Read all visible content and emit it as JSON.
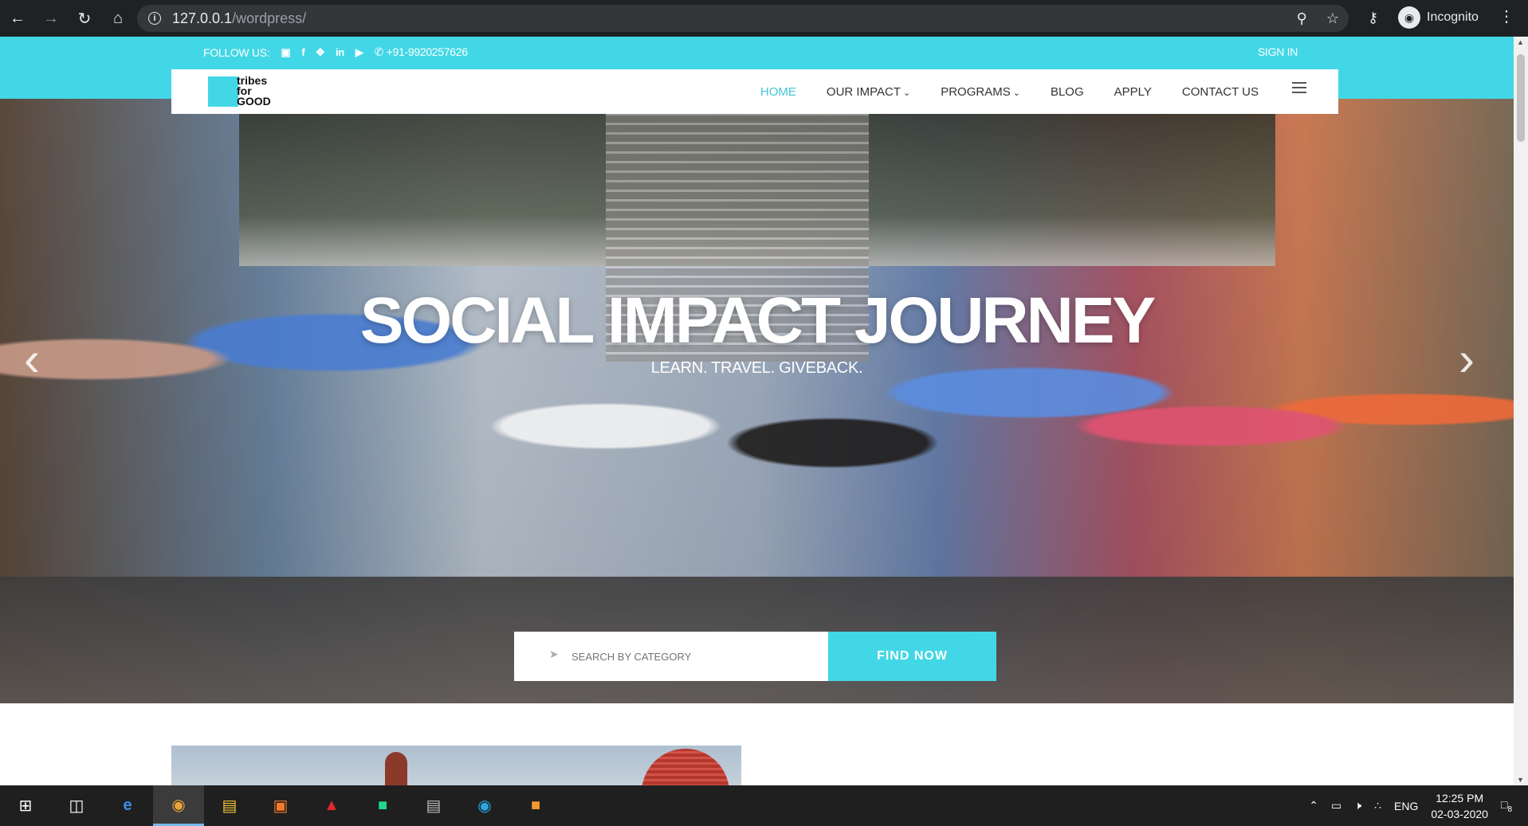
{
  "browser": {
    "url_host": "127.0.0.1",
    "url_path": "/wordpress/",
    "profile_label": "Incognito"
  },
  "topbar": {
    "follow_label": "FOLLOW US:",
    "phone": "+91-9920257626",
    "signin": "SIGN IN",
    "social": [
      "instagram-icon",
      "facebook-icon",
      "twitter-icon",
      "linkedin-icon",
      "youtube-icon"
    ]
  },
  "logo": {
    "line1": "tribes",
    "line2": "for",
    "line3": "GOOD"
  },
  "nav": {
    "home": "HOME",
    "our_impact": "OUR IMPACT",
    "programs": "PROGRAMS",
    "blog": "BLOG",
    "apply": "APPLY",
    "contact": "CONTACT US"
  },
  "hero": {
    "title": "SOCIAL IMPACT JOURNEY",
    "subtitle": "LEARN. TRAVEL. GIVEBACK."
  },
  "search": {
    "placeholder": "SEARCH BY CATEGORY",
    "button": "FIND NOW"
  },
  "taskbar": {
    "tray_lang": "ENG",
    "time": "12:25 PM",
    "date": "02-03-2020",
    "notifications": "8"
  },
  "colors": {
    "accent": "#42d7e6",
    "chrome": "#202124",
    "taskbar": "#1f1f1f"
  }
}
